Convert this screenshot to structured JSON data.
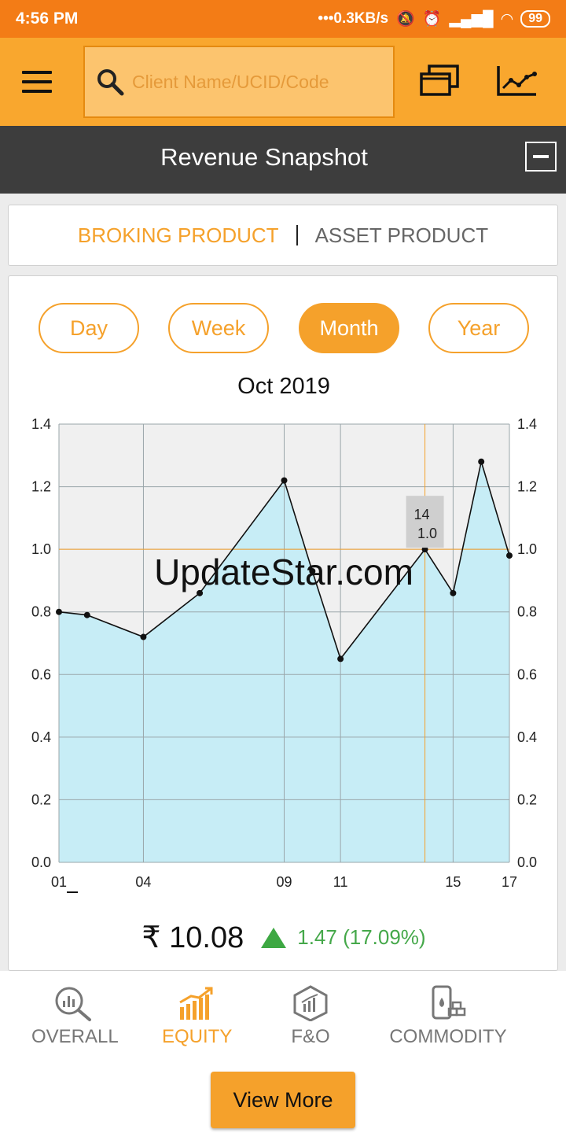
{
  "status_bar": {
    "time": "4:56 PM",
    "net_speed": "•••0.3KB/s",
    "battery": "99"
  },
  "app_bar": {
    "search_placeholder": "Client Name/UCID/Code",
    "icons": [
      "menu-icon",
      "search-icon",
      "multi-window-icon",
      "line-chart-icon"
    ]
  },
  "section": {
    "title": "Revenue Snapshot"
  },
  "product_tabs": [
    {
      "label": "BROKING PRODUCT",
      "active": true
    },
    {
      "label": "ASSET PRODUCT",
      "active": false
    }
  ],
  "period_tabs": [
    {
      "label": "Day",
      "active": false
    },
    {
      "label": "Week",
      "active": false
    },
    {
      "label": "Month",
      "active": true
    },
    {
      "label": "Year",
      "active": false
    }
  ],
  "chart_data": {
    "type": "area",
    "title": "Oct 2019",
    "x": [
      1,
      2,
      4,
      6,
      9,
      10,
      11,
      14,
      15,
      16,
      17
    ],
    "values": [
      0.8,
      0.79,
      0.72,
      0.86,
      1.22,
      0.93,
      0.65,
      1.0,
      0.86,
      1.28,
      0.98
    ],
    "x_ticks": [
      "01",
      "04",
      "09",
      "11",
      "15",
      "17"
    ],
    "y_ticks": [
      "0.0",
      "0.2",
      "0.4",
      "0.6",
      "0.8",
      "1.0",
      "1.2",
      "1.4"
    ],
    "ylim": [
      0,
      1.4
    ],
    "grid": true,
    "dual_y_axis": true,
    "tooltip": {
      "x_label": "14",
      "y_label": "1.0"
    },
    "watermark": "UpdateStar.com",
    "colors": {
      "fill": "#c7edf6",
      "line": "#111111",
      "plot_bg": "#f0f0f0",
      "crosshair": "#f5a12b"
    }
  },
  "summary": {
    "amount": "₹ 10.08",
    "change": "1.47 (17.09%)",
    "trend": "up"
  },
  "categories": [
    {
      "label": "OVERALL",
      "icon": "magnifier-chart-icon",
      "active": false
    },
    {
      "label": "EQUITY",
      "icon": "rising-bars-icon",
      "active": true
    },
    {
      "label": "F&O",
      "icon": "hexagon-chart-icon",
      "active": false
    },
    {
      "label": "COMMODITY",
      "icon": "commodity-icon",
      "active": false
    }
  ],
  "view_more_label": "View More",
  "colors": {
    "accent": "#f5a12b",
    "status_bar": "#f37c16",
    "app_bar": "#f9a72e",
    "header": "#3d3d3d",
    "positive": "#45a84a"
  }
}
